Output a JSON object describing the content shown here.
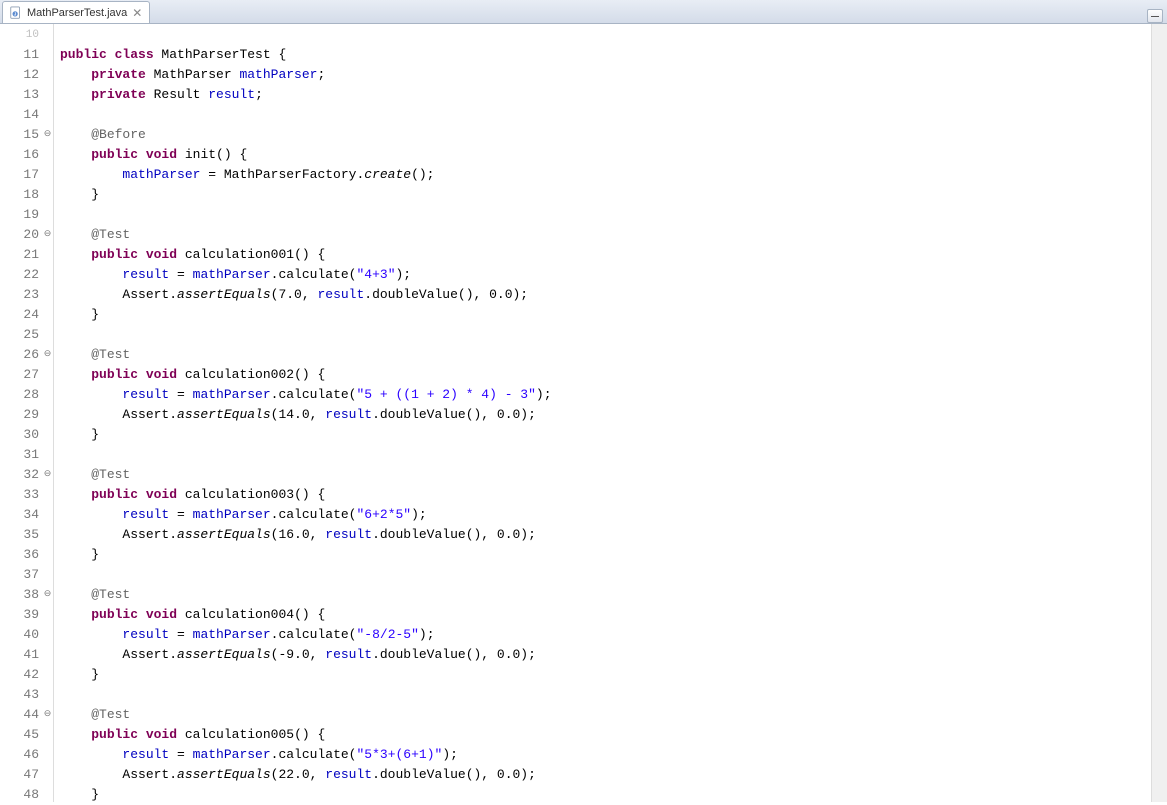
{
  "tab": {
    "filename": "MathParserTest.java",
    "close_glyph": "✕"
  },
  "gutter": [
    {
      "num": "10",
      "half": true
    },
    {
      "num": "11"
    },
    {
      "num": "12"
    },
    {
      "num": "13"
    },
    {
      "num": "14"
    },
    {
      "num": "15",
      "fold": true
    },
    {
      "num": "16"
    },
    {
      "num": "17"
    },
    {
      "num": "18"
    },
    {
      "num": "19"
    },
    {
      "num": "20",
      "fold": true
    },
    {
      "num": "21"
    },
    {
      "num": "22"
    },
    {
      "num": "23"
    },
    {
      "num": "24"
    },
    {
      "num": "25"
    },
    {
      "num": "26",
      "fold": true
    },
    {
      "num": "27"
    },
    {
      "num": "28"
    },
    {
      "num": "29"
    },
    {
      "num": "30"
    },
    {
      "num": "31"
    },
    {
      "num": "32",
      "fold": true
    },
    {
      "num": "33"
    },
    {
      "num": "34"
    },
    {
      "num": "35"
    },
    {
      "num": "36"
    },
    {
      "num": "37"
    },
    {
      "num": "38",
      "fold": true
    },
    {
      "num": "39"
    },
    {
      "num": "40"
    },
    {
      "num": "41"
    },
    {
      "num": "42"
    },
    {
      "num": "43"
    },
    {
      "num": "44",
      "fold": true
    },
    {
      "num": "45"
    },
    {
      "num": "46"
    },
    {
      "num": "47"
    },
    {
      "num": "48"
    }
  ],
  "code": {
    "class_decl": {
      "kw": "public class",
      "name": " MathParserTest {"
    },
    "field1": {
      "kw": "private",
      "type": " MathParser ",
      "name": "mathParser",
      "sc": ";"
    },
    "field2": {
      "kw": "private",
      "type": " Result ",
      "name": "result",
      "sc": ";"
    },
    "ann_before": "@Before",
    "ann_test": "@Test",
    "init_sig": {
      "kw": "public void",
      "rest": " init() {"
    },
    "init_body": {
      "lhs": "mathParser",
      "rest": " = MathParserFactory.",
      "m": "create",
      "tail": "();"
    },
    "close_brace": "}",
    "calc": [
      {
        "sig": {
          "kw": "public void",
          "rest": " calculation001() {"
        },
        "line1": {
          "lhs": "result",
          "mid": " = ",
          "rhs": "mathParser",
          "call": ".calculate(",
          "str": "\"4+3\"",
          "tail": ");"
        },
        "line2": {
          "pre": "Assert.",
          "m": "assertEquals",
          "args1": "(7.0, ",
          "fld": "result",
          "args2": ".doubleValue(), 0.0);"
        }
      },
      {
        "sig": {
          "kw": "public void",
          "rest": " calculation002() {"
        },
        "line1": {
          "lhs": "result",
          "mid": " = ",
          "rhs": "mathParser",
          "call": ".calculate(",
          "str": "\"5 + ((1 + 2) * 4) - 3\"",
          "tail": ");"
        },
        "line2": {
          "pre": "Assert.",
          "m": "assertEquals",
          "args1": "(14.0, ",
          "fld": "result",
          "args2": ".doubleValue(), 0.0);"
        }
      },
      {
        "sig": {
          "kw": "public void",
          "rest": " calculation003() {"
        },
        "line1": {
          "lhs": "result",
          "mid": " = ",
          "rhs": "mathParser",
          "call": ".calculate(",
          "str": "\"6+2*5\"",
          "tail": ");"
        },
        "line2": {
          "pre": "Assert.",
          "m": "assertEquals",
          "args1": "(16.0, ",
          "fld": "result",
          "args2": ".doubleValue(), 0.0);"
        }
      },
      {
        "sig": {
          "kw": "public void",
          "rest": " calculation004() {"
        },
        "line1": {
          "lhs": "result",
          "mid": " = ",
          "rhs": "mathParser",
          "call": ".calculate(",
          "str": "\"-8/2-5\"",
          "tail": ");"
        },
        "line2": {
          "pre": "Assert.",
          "m": "assertEquals",
          "args1": "(-9.0, ",
          "fld": "result",
          "args2": ".doubleValue(), 0.0);"
        }
      },
      {
        "sig": {
          "kw": "public void",
          "rest": " calculation005() {"
        },
        "line1": {
          "lhs": "result",
          "mid": " = ",
          "rhs": "mathParser",
          "call": ".calculate(",
          "str": "\"5*3+(6+1)\"",
          "tail": ");"
        },
        "line2": {
          "pre": "Assert.",
          "m": "assertEquals",
          "args1": "(22.0, ",
          "fld": "result",
          "args2": ".doubleValue(), 0.0);"
        }
      }
    ]
  }
}
